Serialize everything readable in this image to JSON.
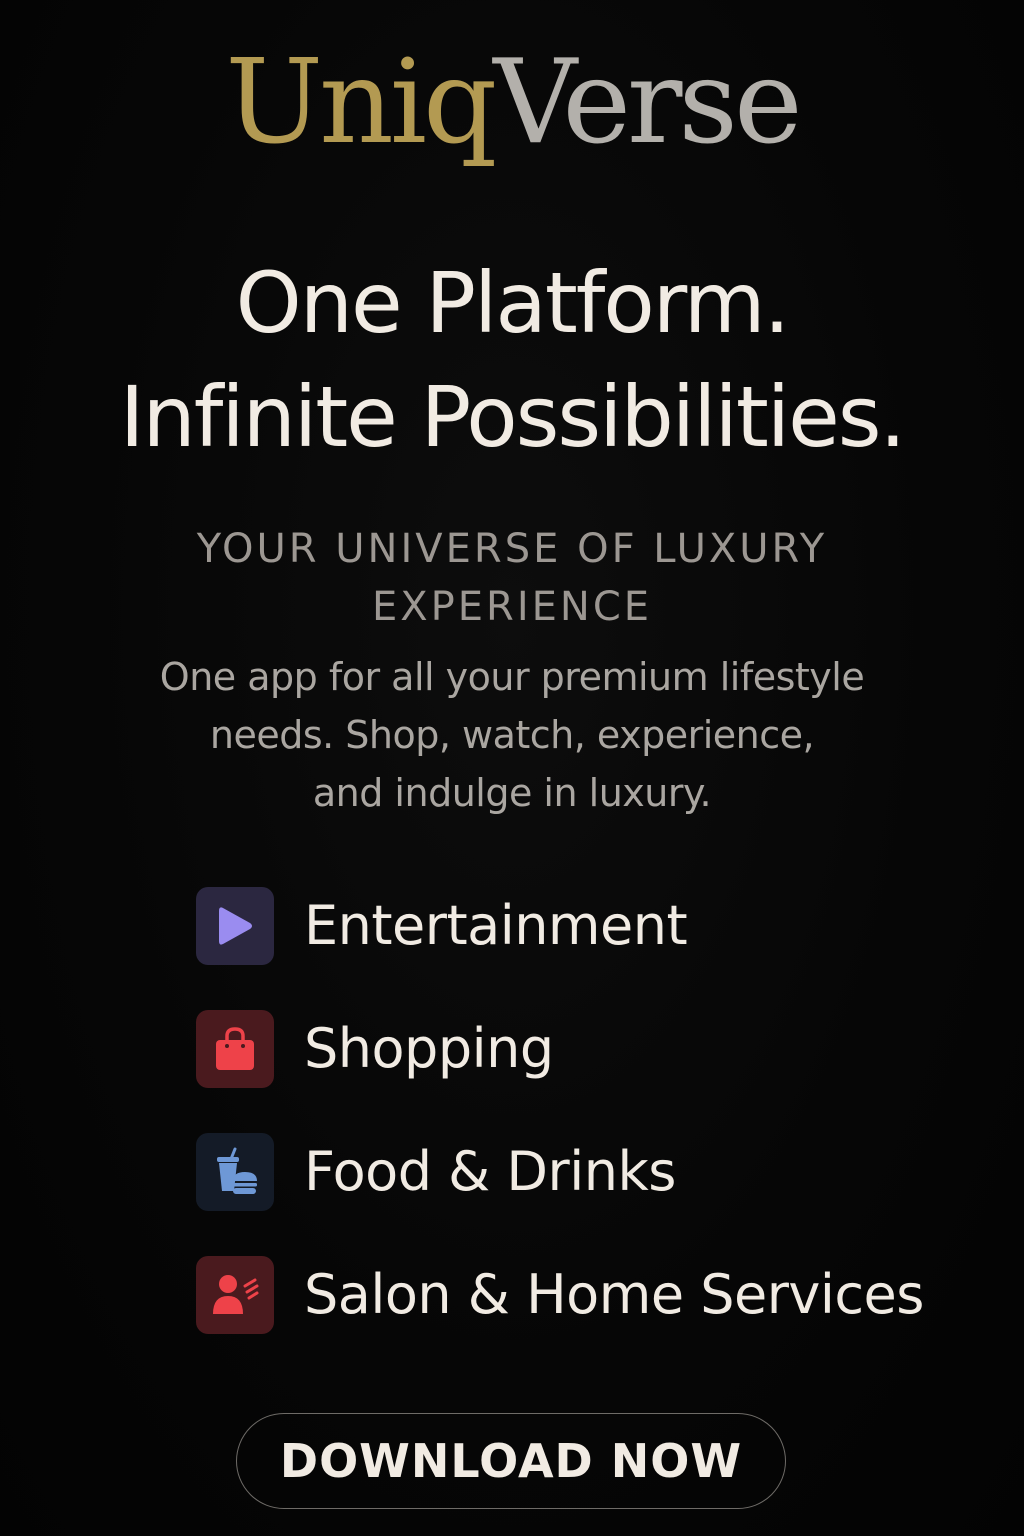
{
  "logo": {
    "part1": "Uniq",
    "part2": "Verse",
    "part1_color": "#b39a52",
    "part2_color": "#b3b0ab"
  },
  "headline": {
    "line1": "One Platform.",
    "line2": "Infinite Possibilities."
  },
  "tagline": {
    "line1": "YOUR UNIVERSE OF LUXURY",
    "line2": "EXPERIENCE"
  },
  "description": {
    "line1": "One app for all your premium lifestyle",
    "line2": "needs. Shop, watch, experience,",
    "line3": "and indulge in luxury."
  },
  "categories": [
    {
      "label": "Entertainment",
      "icon": "play-icon",
      "icon_bg": "#2b2740",
      "icon_color": "#9a8cf0"
    },
    {
      "label": "Shopping",
      "icon": "shopping-bag-icon",
      "icon_bg": "#4a1a1e",
      "icon_color": "#ee4249"
    },
    {
      "label": "Food & Drinks",
      "icon": "food-drink-icon",
      "icon_bg": "#141b27",
      "icon_color": "#6e98d6"
    },
    {
      "label": "Salon & Home Services",
      "icon": "salon-services-icon",
      "icon_bg": "#4a1a1e",
      "icon_color": "#ee4249"
    }
  ],
  "cta": {
    "label": "DOWNLOAD NOW"
  },
  "colors": {
    "background": "#050505",
    "text_primary": "#f1ebe3",
    "text_muted": "#9c9792"
  }
}
